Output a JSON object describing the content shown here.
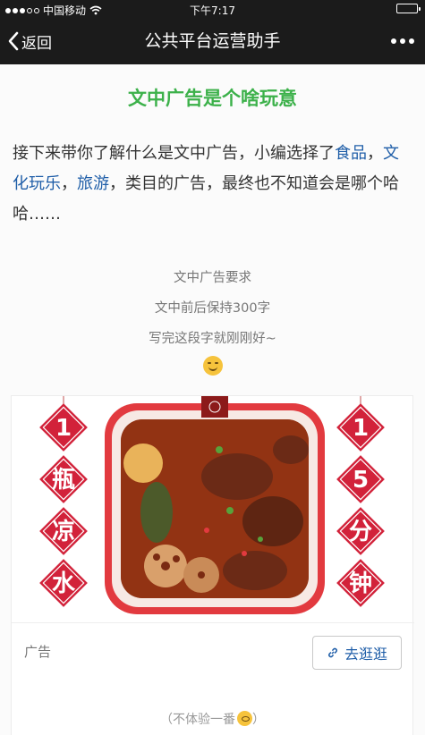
{
  "status_bar": {
    "carrier": "中国移动",
    "time": "下午7:17"
  },
  "navbar": {
    "back_label": "返回",
    "title": "公共平台运营助手"
  },
  "article": {
    "headline": "文中广告是个啥玩意",
    "para_parts": [
      "接下来带你了解什么是文中广告，小编选择了",
      "食品",
      "，",
      "文化玩乐",
      "，",
      "旅游",
      "，类目的广告，最终也不知道会是哪个哈哈……"
    ],
    "center_lines": [
      "文中广告要求",
      "文中前后保持300字",
      "写完这段字就刚刚好~"
    ],
    "closing": "（不体验一番"
  },
  "ad": {
    "left_chars": [
      "1",
      "瓶",
      "凉",
      "水"
    ],
    "right_chars": [
      "1",
      "5",
      "分",
      "钟"
    ],
    "label": "广告",
    "button_label": "去逛逛"
  },
  "colors": {
    "accent_green": "#3cb14a",
    "link_blue": "#1f5ea8",
    "ad_red": "#d2223a"
  }
}
